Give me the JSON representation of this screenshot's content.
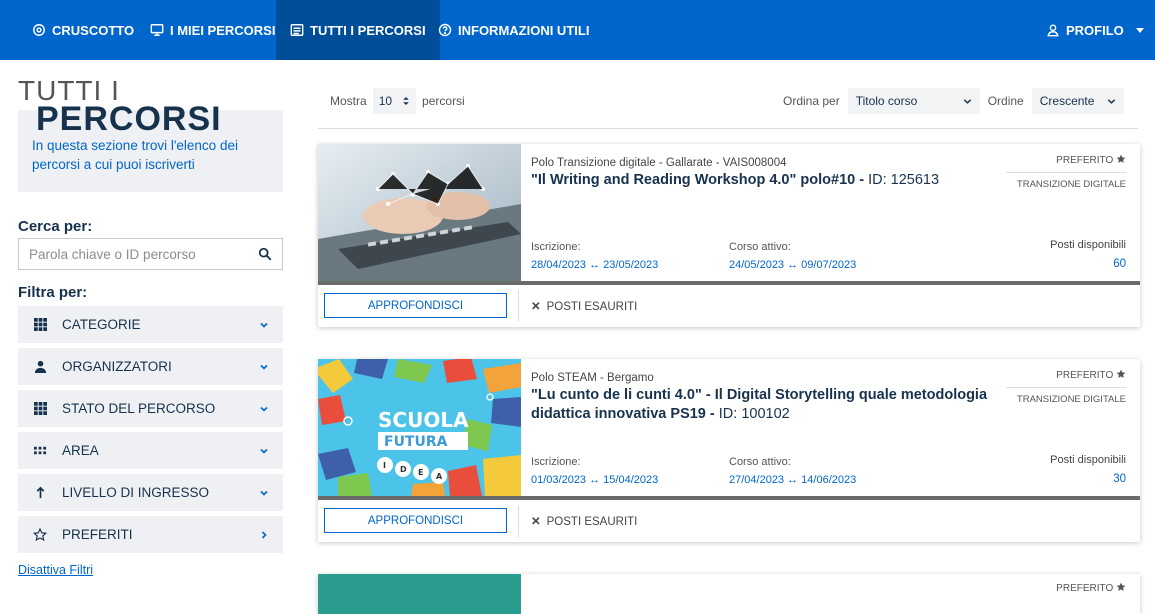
{
  "nav": {
    "items": [
      {
        "label": "CRUSCOTTO",
        "icon": "dashboard-icon"
      },
      {
        "label": "I MIEI PERCORSI",
        "icon": "monitor-icon"
      },
      {
        "label": "TUTTI I PERCORSI",
        "icon": "list-icon"
      },
      {
        "label": "INFORMAZIONI UTILI",
        "icon": "help-icon"
      }
    ],
    "profile": "PROFILO"
  },
  "sidebar": {
    "title_line1": "TUTTI I",
    "title_line2": "PERCORSI",
    "intro_line1": "In questa sezione trovi l'elenco dei",
    "intro_line2": "percorsi a cui puoi iscriverti",
    "search_label": "Cerca per:",
    "search_placeholder": "Parola chiave o ID percorso",
    "filter_label": "Filtra per:",
    "filters": [
      {
        "label": "CATEGORIE",
        "icon": "grid-icon"
      },
      {
        "label": "ORGANIZZATORI",
        "icon": "user-icon"
      },
      {
        "label": "STATO DEL PERCORSO",
        "icon": "grid-icon"
      },
      {
        "label": "AREA",
        "icon": "dots-grid-icon"
      },
      {
        "label": "LIVELLO DI INGRESSO",
        "icon": "arrow-up-icon"
      },
      {
        "label": "PREFERITI",
        "icon": "star-icon"
      }
    ],
    "disable_filters": "Disattiva Filtri"
  },
  "controls": {
    "show_label": "Mostra",
    "show_value": "10",
    "show_suffix": "percorsi",
    "sort_label": "Ordina per",
    "sort_value": "Titolo corso",
    "order_label": "Ordine",
    "order_value": "Crescente"
  },
  "cards": [
    {
      "org": "Polo Transizione digitale - Gallarate - VAIS008004",
      "title": "\"Il Writing and Reading Workshop 4.0\" polo#10 -",
      "id": "ID: 125613",
      "favorite": "PREFERITO",
      "tag": "TRANSIZIONE DIGITALE",
      "enroll_label": "Iscrizione:",
      "enroll_dates": "28/04/2023 ↔ 23/05/2023",
      "active_label": "Corso attivo:",
      "active_dates": "24/05/2023 ↔ 09/07/2023",
      "seats_label": "Posti disponibili",
      "seats": "60",
      "button": "APPROFONDISCI",
      "status": "POSTI ESAURITI"
    },
    {
      "org": "Polo STEAM - Bergamo",
      "title": "\"Lu cunto de li cunti 4.0\" - Il Digital Storytelling quale metodologia didattica innovativa PS19 -",
      "id": "ID: 100102",
      "favorite": "PREFERITO",
      "tag": "TRANSIZIONE DIGITALE",
      "enroll_label": "Iscrizione:",
      "enroll_dates": "01/03/2023 ↔ 15/04/2023",
      "active_label": "Corso attivo:",
      "active_dates": "27/04/2023 ↔ 14/06/2023",
      "seats_label": "Posti disponibili",
      "seats": "30",
      "button": "APPROFONDISCI",
      "status": "POSTI ESAURITI",
      "image_text_1": "SCUOLA",
      "image_text_2": "FUTURA"
    },
    {
      "favorite": "PREFERITO"
    }
  ],
  "colors": {
    "primary": "#0066cc",
    "nav_active": "#004d99",
    "heading": "#17324d",
    "sidebar_bg": "#eef0f3"
  }
}
